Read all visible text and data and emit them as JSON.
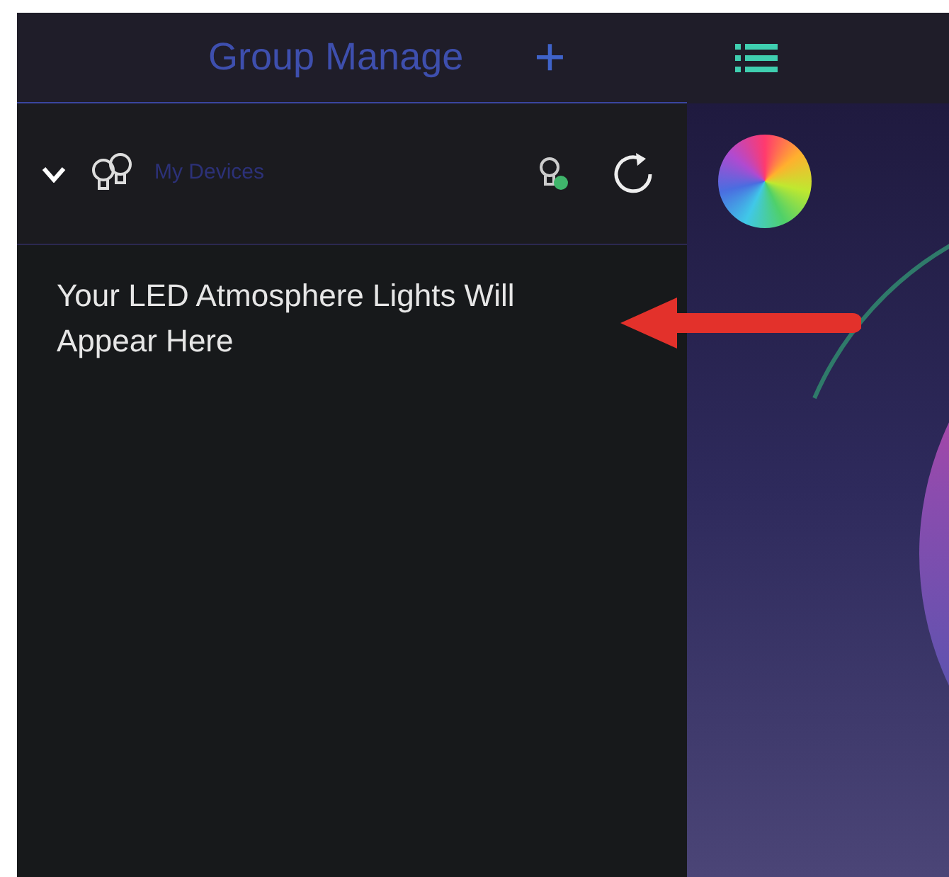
{
  "sidebar": {
    "title": "Group Manage",
    "add_button": "+",
    "group": {
      "name": "My Devices",
      "expanded": true
    },
    "empty_message": "Your LED Atmosphere Lights Will Appear Here"
  }
}
